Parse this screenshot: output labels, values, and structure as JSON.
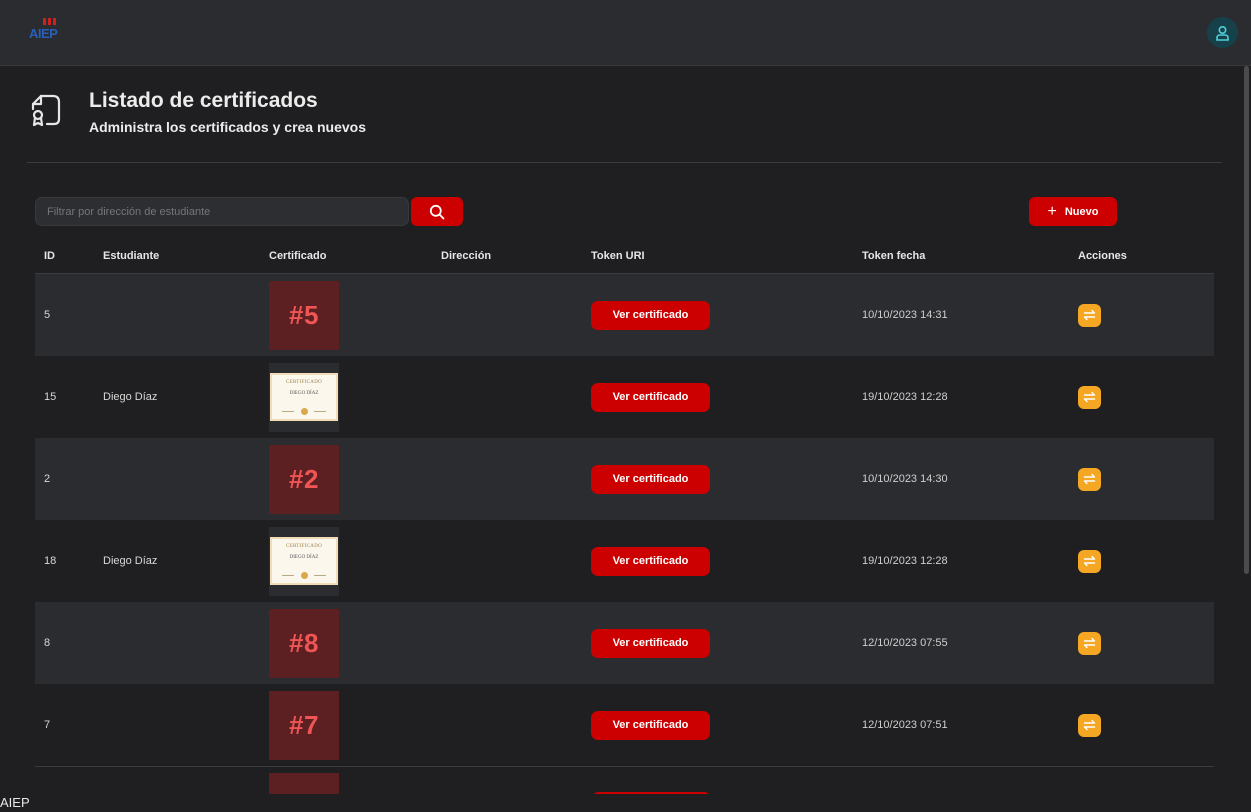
{
  "topbar": {
    "logo_text": "AIEP",
    "user_icon": "user-icon"
  },
  "header": {
    "icon": "certificate-file-icon",
    "title": "Listado de certificados",
    "subtitle": "Administra los certificados y crea nuevos"
  },
  "toolbar": {
    "search_placeholder": "Filtrar por dirección de estudiante",
    "search_value": "",
    "search_icon": "search-icon",
    "new_label": "Nuevo",
    "new_icon": "plus-icon"
  },
  "table": {
    "columns": [
      "ID",
      "Estudiante",
      "Certificado",
      "Dirección",
      "Token URI",
      "Token fecha",
      "Acciones"
    ],
    "rows": [
      {
        "id": "5",
        "student": "",
        "cert_type": "tile",
        "cert_label": "#5",
        "address": "",
        "token_uri": "Ver certificado",
        "token_date": "10/10/2023 14:31",
        "action_icon": "swap-arrows-icon"
      },
      {
        "id": "15",
        "student": "Diego Díaz",
        "cert_type": "image",
        "cert_label": "CERTIFICADO",
        "cert_name": "DIEGO DÍAZ",
        "address": "",
        "token_uri": "Ver certificado",
        "token_date": "19/10/2023 12:28",
        "action_icon": "swap-arrows-icon"
      },
      {
        "id": "2",
        "student": "",
        "cert_type": "tile",
        "cert_label": "#2",
        "address": "",
        "token_uri": "Ver certificado",
        "token_date": "10/10/2023 14:30",
        "action_icon": "swap-arrows-icon"
      },
      {
        "id": "18",
        "student": "Diego Díaz",
        "cert_type": "image",
        "cert_label": "CERTIFICADO",
        "cert_name": "DIEGO DÍAZ",
        "address": "",
        "token_uri": "Ver certificado",
        "token_date": "19/10/2023 12:28",
        "action_icon": "swap-arrows-icon"
      },
      {
        "id": "8",
        "student": "",
        "cert_type": "tile",
        "cert_label": "#8",
        "address": "",
        "token_uri": "Ver certificado",
        "token_date": "12/10/2023 07:55",
        "action_icon": "swap-arrows-icon"
      },
      {
        "id": "7",
        "student": "",
        "cert_type": "tile",
        "cert_label": "#7",
        "address": "",
        "token_uri": "Ver certificado",
        "token_date": "12/10/2023 07:51",
        "action_icon": "swap-arrows-icon"
      }
    ]
  },
  "footer": {
    "label": "AIEP"
  },
  "colors": {
    "background": "#1f1f21",
    "topbar": "#2b2c2f",
    "accent_red": "#cc0000",
    "tile_bg": "#5c2022",
    "tile_text": "#f05555",
    "action_orange": "#f5a623",
    "user_avatar_bg": "#16414a"
  }
}
